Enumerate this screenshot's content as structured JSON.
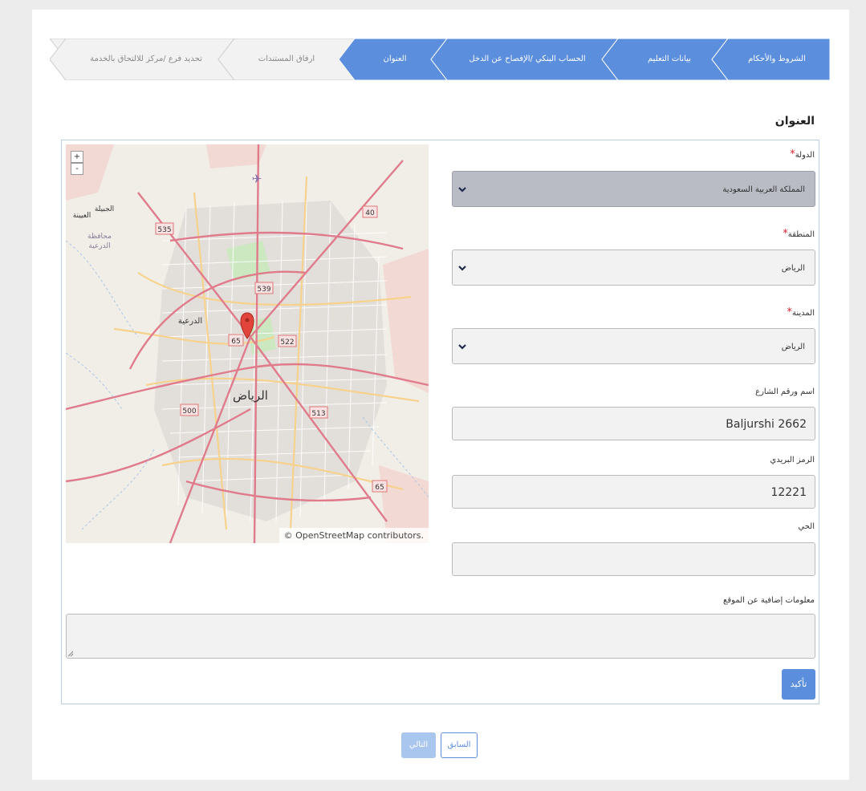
{
  "stepper": {
    "steps": [
      {
        "label": "الشروط والأحكام",
        "state": "active"
      },
      {
        "label": "بيانات التعليم",
        "state": "active"
      },
      {
        "label": "الحساب البنكي /الإفصاح عن الدخل",
        "state": "active"
      },
      {
        "label": "العنوان",
        "state": "active"
      },
      {
        "label": "ارفاق المستندات",
        "state": "inactive"
      },
      {
        "label": "تحديد فرع /مركز للالتحاق بالخدمة",
        "state": "inactive"
      }
    ]
  },
  "section": {
    "title": "العنوان"
  },
  "form": {
    "country": {
      "label": "الدولة",
      "required_mark": "*",
      "value": "المملكة العربية السعودية"
    },
    "region": {
      "label": "المنطقة",
      "required_mark": "*",
      "value": "الرياض"
    },
    "city": {
      "label": "المدينة",
      "required_mark": "*",
      "value": "الرياض"
    },
    "street": {
      "label": "اسم ورقم الشارع",
      "value": "Baljurshi 2662"
    },
    "postal_code": {
      "label": "الرمز البريدي",
      "value": "12221"
    },
    "district": {
      "label": "الحي",
      "value": ""
    },
    "additional_info": {
      "label": "معلومات إضافية عن الموقع",
      "value": ""
    }
  },
  "map": {
    "zoom_in": "+",
    "zoom_out": "-",
    "attribution": "© OpenStreetMap contributors.",
    "labels": {
      "city": "الرياض",
      "diriyah": "الدرعية",
      "diriyah_gov_1": "محافظة",
      "diriyah_gov_2": "الدرعية",
      "jubaila": "الجبيلة",
      "uyaynah": "العيينة"
    },
    "road_shields": [
      "535",
      "539",
      "65",
      "522",
      "40",
      "500",
      "513",
      "65"
    ]
  },
  "buttons": {
    "confirm": "تأكيد",
    "next": "التالي",
    "previous": "السابق"
  },
  "colors": {
    "primary": "#5b8fde",
    "step_inactive": "#f2f2f2",
    "select_first_bg": "#b9bcc5",
    "required": "#d9232e"
  }
}
